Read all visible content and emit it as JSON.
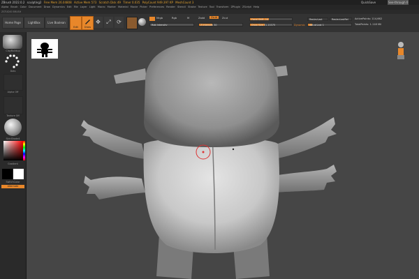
{
  "titlebar": {
    "app": "ZBrush 2022.0.2",
    "doc": "sculpting2",
    "free_mem": "Free Mem 26.04808",
    "active_mem": "Active Mem 573",
    "scratch": "Scratch Disk 49",
    "timer": "Timer 0.035",
    "polycount": "PolyCount 949.397 KP",
    "meshcount": "MeshCount 3",
    "quicksave": "QuickSave",
    "see_through": "See-through 0"
  },
  "menu": [
    "Alpha",
    "Brush",
    "Color",
    "Document",
    "Draw",
    "Dynamics",
    "Edit",
    "File",
    "Layer",
    "Light",
    "Macro",
    "Marker",
    "Material",
    "Movie",
    "Picker",
    "Preferences",
    "Render",
    "Stencil",
    "Stroke",
    "Texture",
    "Tool",
    "Transform",
    "ZPlugin",
    "ZScript",
    "Help"
  ],
  "subbar": "ZSTUDIO BRUSH",
  "toolbar": {
    "home_page": "Home Page",
    "lightbox": "LightBox",
    "live_boolean": "Live Boolean",
    "edit": "Edit",
    "draw": "Draw",
    "move": "Move",
    "scale": "Scale",
    "rotate": "Rotate",
    "mrgb": "Mrgb",
    "rgb": "Rgb",
    "m": "M",
    "zadd": "Zadd",
    "zsub": "Zsub",
    "zcut": "Zcut",
    "rgb_intensity": "Rgb Intensity",
    "z_intensity": "Z Intensity 30",
    "focal_shift": "Focal Shift -14",
    "draw_size": "Draw Size 51.20375",
    "dynamic": "Dynamic",
    "z_intensity_value": 0.3,
    "focal_shift_value": 0.45,
    "draw_size_value": 0.35,
    "adjust_last_value": 0.1,
    "rgb_intensity_value": 1,
    "replay_last": "ReplayLast",
    "replay_last_rel": "ReplayLastRel",
    "adjust_last": "AdjustLast 1",
    "active_points": "ActivePoints: 114,662",
    "total_points": "TotalPoints: 1.118 Mil"
  },
  "leftpanel": {
    "brush": "ClayBuildup",
    "stroke": "Dots",
    "alpha": "Alpha Off",
    "texture": "Texture Off",
    "material": "SkinShade4",
    "gradient": "Gradient",
    "switch_color": "SwitchColor",
    "alternate": "Alternate"
  },
  "colors": {
    "accent": "#e8872a",
    "bg": "#1d1d1d",
    "canvas": "#464646",
    "panel": "#2a2a2a"
  },
  "icons": [
    "draw-icon",
    "move-icon",
    "scale-icon",
    "rotate-icon",
    "material-swatch-icon",
    "sphere-icon",
    "perspective-icon"
  ]
}
